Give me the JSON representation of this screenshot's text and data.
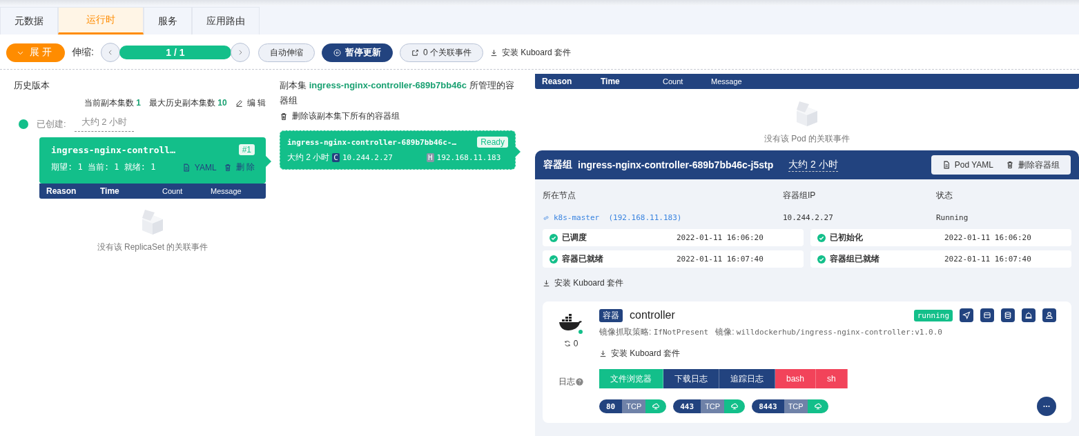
{
  "tabs": [
    {
      "label": "元数据",
      "selected": false
    },
    {
      "label": "运行时",
      "selected": true
    },
    {
      "label": "服务",
      "selected": false
    },
    {
      "label": "应用路由",
      "selected": false
    }
  ],
  "toolbar": {
    "expand_button": "展开",
    "scale_label": "伸缩:",
    "pager": "1 / 1",
    "auto_scale_button": "自动伸缩",
    "pause_button": "暂停更新",
    "events_button": "0 个关联事件",
    "install_link": "安装 Kuboard 套件"
  },
  "history": {
    "title": "历史版本",
    "current_label": "当前副本集数",
    "current_value": "1",
    "max_label": "最大历史副本集数",
    "max_value": "10",
    "edit_link": "编 辑",
    "created_label": "已创建:",
    "created_value": "大约 2 小时",
    "replicaset": {
      "name": "ingress-nginx-controll…",
      "badge": "#1",
      "stats": "期望: 1 当前: 1 就绪: 1",
      "yaml_link": "YAML",
      "delete_link": "删 除"
    },
    "event_columns": [
      "Reason",
      "Time",
      "Count",
      "Message"
    ],
    "empty": "没有该 ReplicaSet 的关联事件"
  },
  "pods_panel": {
    "title": "副本集 **ingress-nginx-controller-689b7bb46c** 所管理的容器组",
    "delete_all_link": "删除该副本集下所有的容器组",
    "pod": {
      "name": "ingress-nginx-controller-689b7bb46c-…",
      "status": "Ready",
      "age": "大约 2 小时",
      "container_ip_tag": "C",
      "container_ip": "10.244.2.27",
      "host_ip_tag": "H",
      "host_ip": "192.168.11.183"
    }
  },
  "pod_events": {
    "columns": [
      "Reason",
      "Time",
      "Count",
      "Message"
    ],
    "empty": "没有该 Pod 的关联事件"
  },
  "pod": {
    "label": "容器组",
    "name": "ingress-nginx-controller-689b7bb46c-j5stp",
    "age": "大约 2 小时",
    "yaml_button": "Pod YAML",
    "delete_button": "删除容器组",
    "node_label": "所在节点",
    "node": "k8s-master  (192.168.11.183)",
    "ip_label": "容器组IP",
    "ip": "10.244.2.27",
    "status_label": "状态",
    "status": "Running",
    "conditions": [
      {
        "label": "已调度",
        "time": "2022-01-11 16:06:20",
        "ok": true
      },
      {
        "label": "已初始化",
        "time": "2022-01-11 16:06:20",
        "ok": true
      },
      {
        "label": "容器已就绪",
        "time": "2022-01-11 16:07:40",
        "ok": true
      },
      {
        "label": "容器组已就绪",
        "time": "2022-01-11 16:07:40",
        "ok": true
      }
    ],
    "install_link": "安装 Kuboard 套件"
  },
  "container": {
    "tag": "容器",
    "name": "controller",
    "state": "running",
    "restarts": "0",
    "pull_policy_label": "镜像抓取策略:",
    "pull_policy": "IfNotPresent",
    "image_label": "镜像:",
    "image": "willdockerhub/ingress-nginx-controller:v1.0.0",
    "install_link": "安装 Kuboard 套件",
    "log_label": "日志",
    "log_buttons": [
      {
        "label": "文件浏览器",
        "kind": "files"
      },
      {
        "label": "下载日志",
        "kind": "log"
      },
      {
        "label": "追踪日志",
        "kind": "log"
      },
      {
        "label": "bash",
        "kind": "shell"
      },
      {
        "label": "sh",
        "kind": "shell"
      }
    ],
    "ports": [
      {
        "port": "80",
        "protocol": "TCP"
      },
      {
        "port": "443",
        "protocol": "TCP"
      },
      {
        "port": "8443",
        "protocol": "TCP"
      }
    ]
  }
}
